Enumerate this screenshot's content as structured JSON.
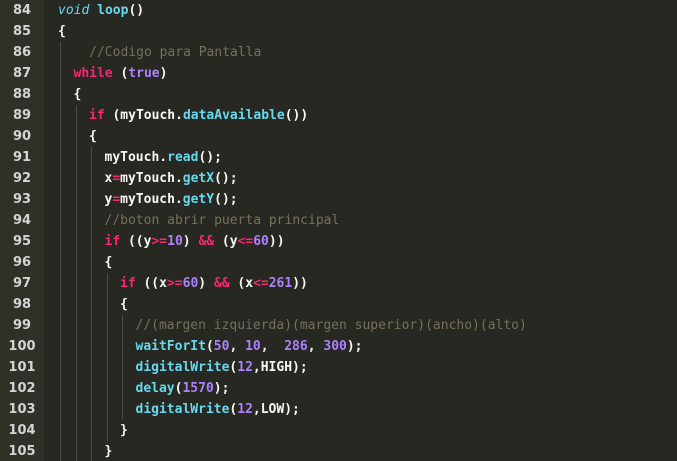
{
  "editor": {
    "theme_colors": {
      "background": "#272822",
      "gutter": "#2f3129",
      "keyword": "#f92672",
      "number_constant": "#ae81ff",
      "function": "#66d9ef",
      "comment": "#75715e",
      "text": "#f8f8f2"
    },
    "lines": [
      {
        "number": "84",
        "indent": 0,
        "tokens": [
          {
            "t": "void",
            "c": "t"
          },
          {
            "t": " ",
            "c": "p"
          },
          {
            "t": "loop",
            "c": "f"
          },
          {
            "t": "()",
            "c": "p"
          }
        ]
      },
      {
        "number": "85",
        "indent": 0,
        "tokens": [
          {
            "t": "{",
            "c": "p"
          }
        ]
      },
      {
        "number": "86",
        "indent": 1,
        "tokens": [
          {
            "t": "  //Codigo para Pantalla",
            "c": "c"
          }
        ]
      },
      {
        "number": "87",
        "indent": 1,
        "tokens": [
          {
            "t": "while",
            "c": "k"
          },
          {
            "t": " (",
            "c": "p"
          },
          {
            "t": "true",
            "c": "s"
          },
          {
            "t": ")",
            "c": "p"
          }
        ]
      },
      {
        "number": "88",
        "indent": 1,
        "tokens": [
          {
            "t": "{",
            "c": "p"
          }
        ]
      },
      {
        "number": "89",
        "indent": 2,
        "tokens": [
          {
            "t": "if",
            "c": "k"
          },
          {
            "t": " (myTouch.",
            "c": "p"
          },
          {
            "t": "dataAvailable",
            "c": "f"
          },
          {
            "t": "())",
            "c": "p"
          }
        ]
      },
      {
        "number": "90",
        "indent": 2,
        "tokens": [
          {
            "t": "{",
            "c": "p"
          }
        ]
      },
      {
        "number": "91",
        "indent": 3,
        "tokens": [
          {
            "t": "myTouch.",
            "c": "p"
          },
          {
            "t": "read",
            "c": "f"
          },
          {
            "t": "();",
            "c": "p"
          }
        ]
      },
      {
        "number": "92",
        "indent": 3,
        "tokens": [
          {
            "t": "x",
            "c": "p"
          },
          {
            "t": "=",
            "c": "k"
          },
          {
            "t": "myTouch.",
            "c": "p"
          },
          {
            "t": "getX",
            "c": "f"
          },
          {
            "t": "();",
            "c": "p"
          }
        ]
      },
      {
        "number": "93",
        "indent": 3,
        "tokens": [
          {
            "t": "y",
            "c": "p"
          },
          {
            "t": "=",
            "c": "k"
          },
          {
            "t": "myTouch.",
            "c": "p"
          },
          {
            "t": "getY",
            "c": "f"
          },
          {
            "t": "();",
            "c": "p"
          }
        ]
      },
      {
        "number": "94",
        "indent": 3,
        "tokens": [
          {
            "t": "//boton abrir puerta principal",
            "c": "c"
          }
        ]
      },
      {
        "number": "95",
        "indent": 3,
        "tokens": [
          {
            "t": "if",
            "c": "k"
          },
          {
            "t": " ((y",
            "c": "p"
          },
          {
            "t": ">=",
            "c": "k"
          },
          {
            "t": "10",
            "c": "s"
          },
          {
            "t": ") ",
            "c": "p"
          },
          {
            "t": "&&",
            "c": "k"
          },
          {
            "t": " (y",
            "c": "p"
          },
          {
            "t": "<=",
            "c": "k"
          },
          {
            "t": "60",
            "c": "s"
          },
          {
            "t": "))",
            "c": "p"
          }
        ]
      },
      {
        "number": "96",
        "indent": 3,
        "tokens": [
          {
            "t": "{",
            "c": "p"
          }
        ]
      },
      {
        "number": "97",
        "indent": 4,
        "tokens": [
          {
            "t": "if",
            "c": "k"
          },
          {
            "t": " ((x",
            "c": "p"
          },
          {
            "t": ">=",
            "c": "k"
          },
          {
            "t": "60",
            "c": "s"
          },
          {
            "t": ") ",
            "c": "p"
          },
          {
            "t": "&&",
            "c": "k"
          },
          {
            "t": " (x",
            "c": "p"
          },
          {
            "t": "<=",
            "c": "k"
          },
          {
            "t": "261",
            "c": "s"
          },
          {
            "t": "))",
            "c": "p"
          }
        ]
      },
      {
        "number": "98",
        "indent": 4,
        "tokens": [
          {
            "t": "{",
            "c": "p"
          }
        ]
      },
      {
        "number": "99",
        "indent": 5,
        "tokens": [
          {
            "t": "//(margen izquierda)(margen superior)(ancho)(alto)",
            "c": "c"
          }
        ]
      },
      {
        "number": "100",
        "indent": 5,
        "tokens": [
          {
            "t": "waitForIt",
            "c": "f"
          },
          {
            "t": "(",
            "c": "p"
          },
          {
            "t": "50",
            "c": "s"
          },
          {
            "t": ", ",
            "c": "p"
          },
          {
            "t": "10",
            "c": "s"
          },
          {
            "t": ",  ",
            "c": "p"
          },
          {
            "t": "286",
            "c": "s"
          },
          {
            "t": ", ",
            "c": "p"
          },
          {
            "t": "300",
            "c": "s"
          },
          {
            "t": ");",
            "c": "p"
          }
        ]
      },
      {
        "number": "101",
        "indent": 5,
        "tokens": [
          {
            "t": "digitalWrite",
            "c": "f"
          },
          {
            "t": "(",
            "c": "p"
          },
          {
            "t": "12",
            "c": "s"
          },
          {
            "t": ",HIGH);",
            "c": "p"
          }
        ]
      },
      {
        "number": "102",
        "indent": 5,
        "tokens": [
          {
            "t": "delay",
            "c": "f"
          },
          {
            "t": "(",
            "c": "p"
          },
          {
            "t": "1570",
            "c": "s"
          },
          {
            "t": ");",
            "c": "p"
          }
        ]
      },
      {
        "number": "103",
        "indent": 5,
        "tokens": [
          {
            "t": "digitalWrite",
            "c": "f"
          },
          {
            "t": "(",
            "c": "p"
          },
          {
            "t": "12",
            "c": "s"
          },
          {
            "t": ",LOW);",
            "c": "p"
          }
        ]
      },
      {
        "number": "104",
        "indent": 4,
        "tokens": [
          {
            "t": "}",
            "c": "p"
          }
        ]
      },
      {
        "number": "105",
        "indent": 3,
        "tokens": [
          {
            "t": "}",
            "c": "p"
          }
        ]
      }
    ]
  }
}
